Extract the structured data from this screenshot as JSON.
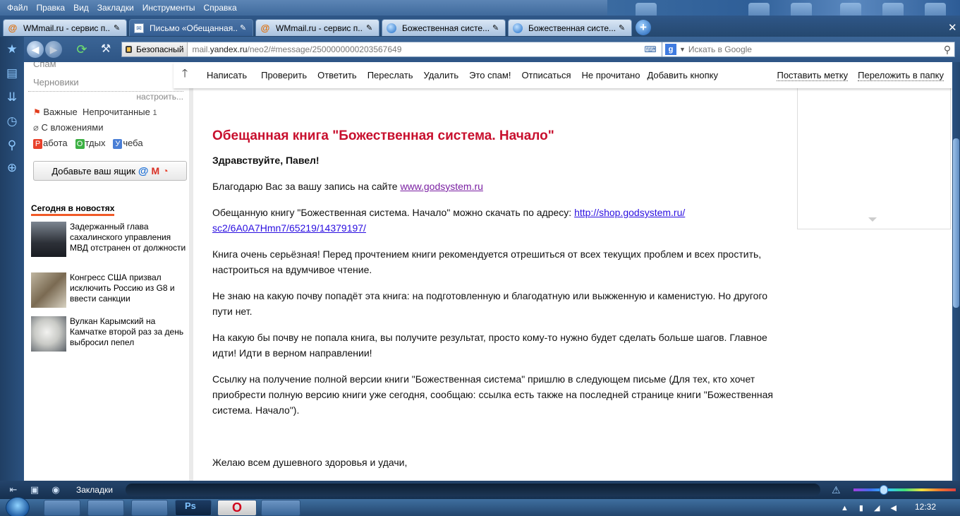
{
  "menu": [
    "Файл",
    "Правка",
    "Вид",
    "Закладки",
    "Инструменты",
    "Справка"
  ],
  "tabs": [
    {
      "title": "WMmail.ru - сервис п...",
      "icon": "at-icon",
      "active": false
    },
    {
      "title": "Письмо «Обещанная...",
      "icon": "mail-icon",
      "active": true
    },
    {
      "title": "WMmail.ru - сервис п...",
      "icon": "at-icon",
      "active": false
    },
    {
      "title": "Божественная систе...",
      "icon": "globe-icon",
      "active": false
    },
    {
      "title": "Божественная систе...",
      "icon": "globe-icon",
      "active": false
    }
  ],
  "address": {
    "secure_label": "Безопасный",
    "url_prefix": "mail.",
    "url_domain": "yandex.ru",
    "url_rest": "/neo2/#message/2500000000203567649",
    "search_placeholder": "Искать в Google"
  },
  "sidebar": {
    "folders": [
      "Спам",
      "Черновики"
    ],
    "settings_link": "настроить...",
    "important": "Важные",
    "unread": "Непрочитанные",
    "unread_count": "1",
    "attachments": "С вложениями",
    "labels": [
      {
        "letter": "Р",
        "rest": "абота",
        "color": "#e8412b"
      },
      {
        "letter": "О",
        "rest": "тдых",
        "color": "#3cb043"
      },
      {
        "letter": "У",
        "rest": "чеба",
        "color": "#4a7fd6"
      }
    ],
    "add_mailbox_label": "Добавьте ваш ящик"
  },
  "news": {
    "heading": "Сегодня в новостях",
    "items": [
      {
        "text": "Задержанный глава сахалинского управления МВД отстранен от должности"
      },
      {
        "text": "Конгресс США призвал исключить Россию из G8 и ввести санкции"
      },
      {
        "text": "Вулкан Карымский на Камчатке второй раз за день выбросил пепел"
      }
    ]
  },
  "toolbar": {
    "buttons": [
      "Написать",
      "Проверить",
      "Ответить",
      "Переслать",
      "Удалить",
      "Это спам!",
      "Отписаться",
      "Не прочитано",
      "Добавить кнопку"
    ],
    "right": [
      "Поставить метку",
      "Переложить в папку"
    ]
  },
  "message": {
    "title": "Обещанная книга \"Божественная система. Начало\"",
    "greeting": "Здравствуйте, Павел!",
    "p1_text": "Благодарю Вас за вашу запись на сайте ",
    "p1_link": "www.godsystem.ru",
    "p2_text": "Обещанную книгу \"Божественная система. Начало\" можно скачать по адресу: ",
    "p2_link_a": "http://shop.godsystem.ru/",
    "p2_link_b": "sc2/6A0A7Hmn7/65219/14379197/",
    "p3": "Книга очень серьёзная! Перед прочтением книги рекомендуется отрешиться от всех текущих проблем и всех простить, настроиться на вдумчивое чтение.",
    "p4": "Не знаю на какую почву попадёт эта книга: на подготовленную и благодатную или выжженную и каменистую. Но другого пути нет.",
    "p5": "На какую бы почву не попала книга, вы получите результат, просто кому-то нужно будет сделать больше шагов. Главное идти! Идти в верном направлении!",
    "p6": "Ссылку на получение полной версии книги \"Божественная система\" пришлю в следующем письме (Для тех, кто хочет приобрести полную версию книги уже сегодня, сообщаю: ссылка есть также на последней странице книги \"Божественная система. Начало\").",
    "p7": "Желаю всем душевного здоровья и удачи,"
  },
  "statusbar": {
    "bookmarks": "Закладки"
  },
  "taskbar": {
    "clock": "12:32"
  }
}
